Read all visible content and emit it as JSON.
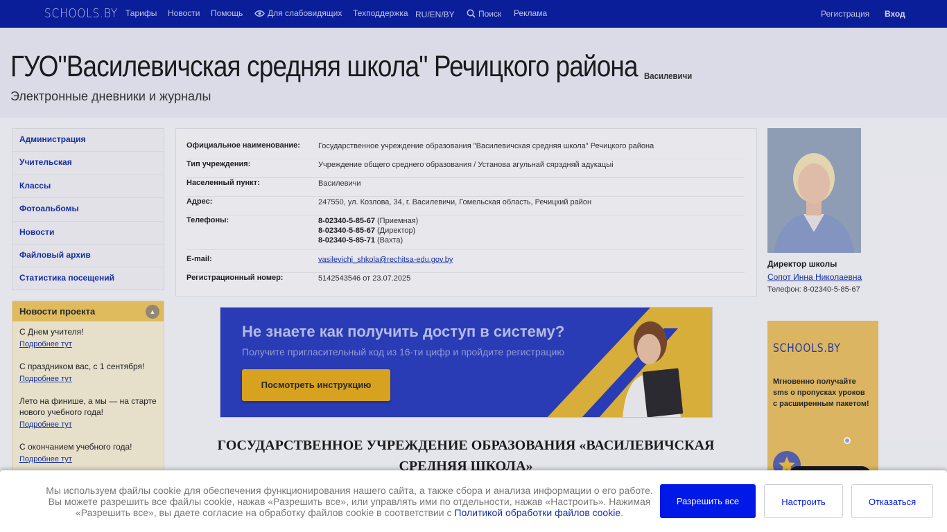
{
  "topbar": {
    "logo": "SCHOOLS.BY",
    "nav": {
      "tariffs": "Тарифы",
      "news": "Новости",
      "help": "Помощь",
      "accessibility": "Для слабовидящих",
      "support": "Техподдержка",
      "lang": "RU/EN/BY",
      "search": "Поиск",
      "ads": "Реклама"
    },
    "register": "Регистрация",
    "login": "Вход"
  },
  "header": {
    "title": "ГУО\"Василевичская средняя школа\" Речицкого района",
    "place": "Василевичи",
    "subtitle": "Электронные дневники и журналы"
  },
  "sidebar": {
    "items": [
      {
        "label": "Администрация"
      },
      {
        "label": "Учительская"
      },
      {
        "label": "Классы"
      },
      {
        "label": "Фотоальбомы"
      },
      {
        "label": "Новости"
      },
      {
        "label": "Файловый архив"
      },
      {
        "label": "Статистика посещений"
      }
    ]
  },
  "project_news": {
    "title": "Новости проекта",
    "more_label": "Подробнее тут",
    "items": [
      {
        "title": "С Днем учителя!"
      },
      {
        "title": "С праздником вас, с 1 сентября!"
      },
      {
        "title": "Лето на финише, а мы — на старте нового учебного года!"
      },
      {
        "title": "С окончанием учебного года!"
      }
    ]
  },
  "info": {
    "official_name": {
      "label": "Официальное наименование:",
      "value": "Государственное учреждение образования \"Василевичская средняя школа\" Речицкого района"
    },
    "type": {
      "label": "Тип учреждения:",
      "value": "Учреждение общего среднего образования / Установа агульнай сярэдняй адукацыі"
    },
    "locality": {
      "label": "Населенный пункт:",
      "value": "Василевичи"
    },
    "address": {
      "label": "Адрес:",
      "value": "247550, ул. Козлова, 34, г. Василевичи, Гомельская область, Речицкий район"
    },
    "phones": {
      "label": "Телефоны:",
      "items": [
        {
          "number": "8-02340-5-85-67",
          "note": "(Приемная)"
        },
        {
          "number": "8-02340-5-85-67",
          "note": "(Директор)"
        },
        {
          "number": "8-02340-5-85-71",
          "note": "(Вахта)"
        }
      ]
    },
    "email": {
      "label": "E-mail:",
      "value": "vasilevichi_shkola@rechitsa-edu.gov.by"
    },
    "reg": {
      "label": "Регистрационный номер:",
      "value": "5142543546 от 23.07.2025"
    }
  },
  "director": {
    "label": "Директор школы",
    "name": "Сопот Инна Николаевна",
    "phone": "Телефон: 8-02340-5-85-67"
  },
  "banner": {
    "title": "Не знаете как получить доступ в систему?",
    "subtitle": "Получите пригласительный код из 16-ти цифр и пройдите регистрацию",
    "button": "Посмотреть инструкцию"
  },
  "main_heading": "ГОСУДАРСТВЕННОЕ УЧРЕЖДЕНИЕ ОБРАЗОВАНИЯ «ВАСИЛЕВИЧСКАЯ СРЕДНЯЯ ШКОЛА»",
  "ad": {
    "logo": "SCHOOLS.BY",
    "text": "Мгновенно получайте sms о пропусках уроков с расширенным пакетом!"
  },
  "cookie": {
    "text": "Мы используем файлы cookie для обеспечения функционирования нашего сайта, а также сбора и анализа информации о его работе. Вы можете разрешить все файлы cookie, нажав «Разрешить все», или управлять ими по отдельности, нажав «Настроить». Нажимая «Разрешить все», вы даете согласие на обработку файлов cookie в соответствии с",
    "link": "Политикой обработки файлов cookie",
    "accept": "Разрешить все",
    "configure": "Настроить",
    "decline": "Отказаться"
  },
  "colors": {
    "topbar": "#0b1fa0",
    "link": "#1731a9",
    "accent_button": "#0019e6",
    "news_header": "#ecc660"
  }
}
